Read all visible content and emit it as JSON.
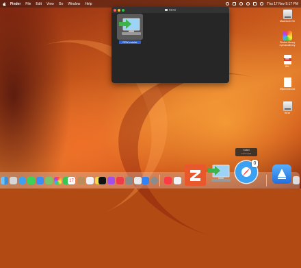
{
  "menubar": {
    "app": "Finder",
    "items": [
      "File",
      "Edit",
      "View",
      "Go",
      "Window",
      "Help"
    ],
    "clock": "Thu 17 Nov  9:17 PM"
  },
  "window": {
    "title": "REW",
    "file": {
      "label": "REW Installer"
    }
  },
  "desktop": {
    "icons": [
      {
        "label": "Macintosh HD",
        "kind": "drive"
      },
      {
        "label": "Photos Library 2.photoslibrary",
        "kind": "photos"
      },
      {
        "label": "Bill-",
        "kind": "pdf",
        "badge": "PDF"
      },
      {
        "label": "rtSpecimen.txt",
        "kind": "txt"
      },
      {
        "label": "REW",
        "kind": "drive"
      }
    ]
  },
  "dock": {
    "tooltip": {
      "title": "Safari",
      "subtitle": "Force Quit"
    },
    "badge": "0",
    "calendar_day": "17",
    "apps": [
      "finder-icon",
      "launchpad-icon",
      "safari-icon",
      "messages-icon",
      "mail-icon",
      "maps-icon",
      "photos-icon",
      "facetime-icon",
      "calendar-icon",
      "contacts-icon",
      "reminders-icon",
      "notes-icon",
      "tv-icon",
      "music-icon",
      "podcasts-icon",
      "news-icon",
      "app-store-icon",
      "system-settings-icon",
      "books-icon",
      "pages-icon",
      "zotero-icon",
      "rew-installer-icon",
      "safari-dragged-icon",
      "downloads-icon",
      "trash-icon"
    ]
  }
}
